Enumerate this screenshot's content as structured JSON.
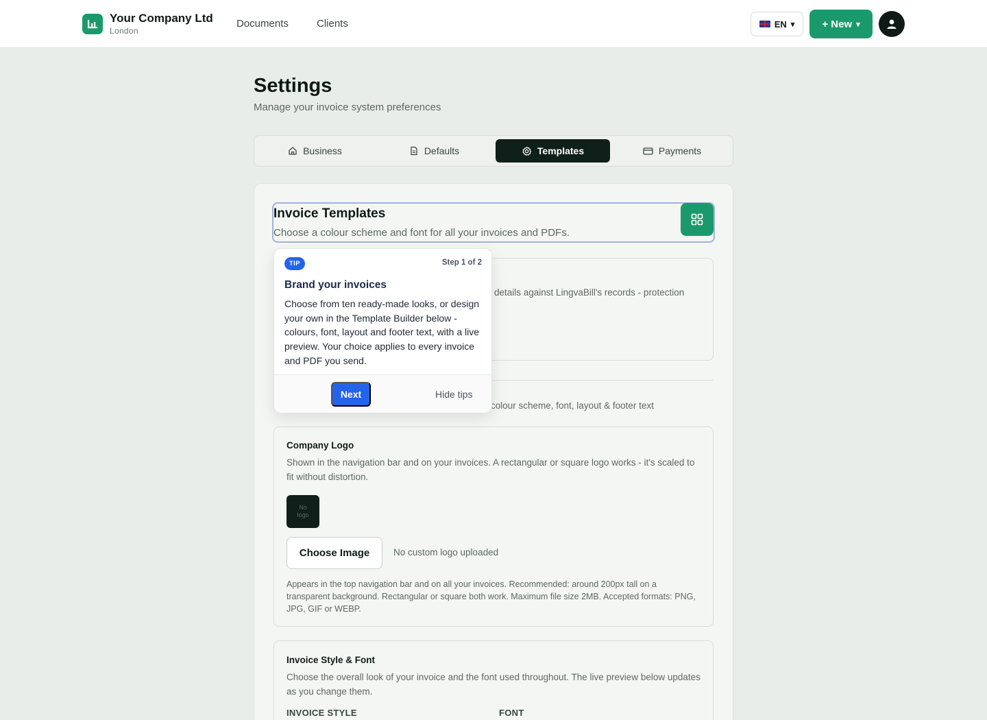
{
  "nav": {
    "company_name": "Your Company Ltd",
    "company_location": "London",
    "links": [
      "Documents",
      "Clients"
    ],
    "language": "EN",
    "new_button": "+ New",
    "caret": "▾"
  },
  "page": {
    "title": "Settings",
    "subtitle": "Manage your invoice system preferences"
  },
  "tabs": [
    {
      "label": "Business",
      "icon": "home-icon",
      "active": false
    },
    {
      "label": "Defaults",
      "icon": "document-icon",
      "active": false
    },
    {
      "label": "Templates",
      "icon": "gear-icon",
      "active": true
    },
    {
      "label": "Payments",
      "icon": "card-icon",
      "active": false
    }
  ],
  "section": {
    "title": "Invoice Templates",
    "subtitle": "Choose a colour scheme and font for all your invoices and PDFs.",
    "protection_text": "details against LingvaBill's records - protection",
    "builder_text": "colour scheme, font, layout & footer text"
  },
  "logo": {
    "title": "Company Logo",
    "description": "Shown in the navigation bar and on your invoices. A rectangular or square logo works - it's scaled to fit without distortion.",
    "placeholder_line1": "No",
    "placeholder_line2": "logo",
    "choose_button": "Choose Image",
    "status": "No custom logo uploaded",
    "help": "Appears in the top navigation bar and on all your invoices. Recommended: around 200px tall on a transparent background. Rectangular or square both work. Maximum file size 2MB. Accepted formats: PNG, JPG, GIF or WEBP."
  },
  "style": {
    "title": "Invoice Style & Font",
    "description": "Choose the overall look of your invoice and the font used throughout. The live preview below updates as you change them.",
    "style_label": "INVOICE STYLE",
    "font_label": "FONT"
  },
  "tip": {
    "badge": "TIP",
    "step": "Step 1 of 2",
    "title": "Brand your invoices",
    "body": "Choose from ten ready-made looks, or design your own in the Template Builder below - colours, font, layout and footer text, with a live preview. Your choice applies to every invoice and PDF you send.",
    "next": "Next",
    "hide": "Hide tips"
  },
  "colors": {
    "brand_green": "#1a9a6c",
    "dark": "#0f1f1a",
    "tip_blue": "#2563eb"
  }
}
